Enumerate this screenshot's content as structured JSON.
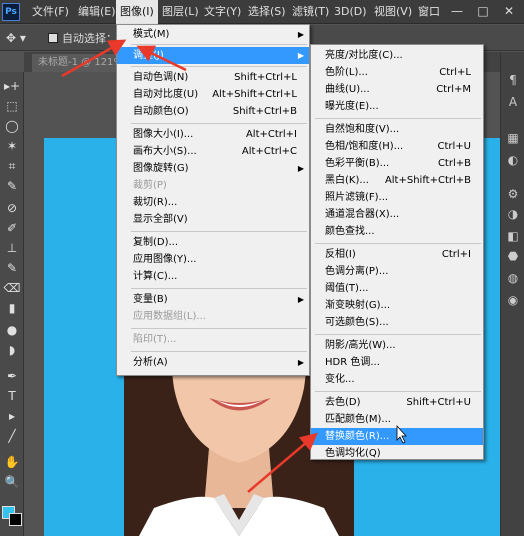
{
  "app": {
    "logo": "Ps"
  },
  "menubar": {
    "items": [
      "文件(F)",
      "编辑(E)",
      "图像(I)",
      "图层(L)",
      "文字(Y)",
      "选择(S)",
      "滤镜(T)",
      "3D(D)",
      "视图(V)",
      "窗口"
    ],
    "window_controls": [
      "—",
      "□",
      "✕"
    ]
  },
  "options_bar": {
    "tool_glyph": "✥ ▾",
    "auto_select_label": "自动选择："
  },
  "doc_tab": {
    "label": "未标题-1 @ 121%"
  },
  "toolbar": {
    "tools": [
      "▸+",
      "⬚",
      "◯",
      "✶",
      "⌗",
      "✎",
      "⊘",
      "✐",
      "⊥",
      "✎",
      "⌫",
      "▮",
      "●",
      "◗",
      "✒",
      "T",
      "▸",
      "╱",
      "✋",
      "🔍"
    ]
  },
  "right_panel": {
    "icons": [
      "¶",
      "A",
      "▦",
      "◐",
      "⚙",
      "◑",
      "◧",
      "⬣",
      "◍",
      "◉"
    ]
  },
  "image_menu": {
    "items": [
      {
        "label": "模式(M)",
        "shortcut": "",
        "submenu": true,
        "disabled": false,
        "highlighted": false
      },
      {
        "label": "调整(J)",
        "shortcut": "",
        "submenu": true,
        "disabled": false,
        "highlighted": true
      },
      {
        "label": "自动色调(N)",
        "shortcut": "Shift+Ctrl+L",
        "submenu": false,
        "disabled": false,
        "highlighted": false
      },
      {
        "label": "自动对比度(U)",
        "shortcut": "Alt+Shift+Ctrl+L",
        "submenu": false,
        "disabled": false,
        "highlighted": false
      },
      {
        "label": "自动颜色(O)",
        "shortcut": "Shift+Ctrl+B",
        "submenu": false,
        "disabled": false,
        "highlighted": false
      },
      {
        "label": "图像大小(I)...",
        "shortcut": "Alt+Ctrl+I",
        "submenu": false,
        "disabled": false,
        "highlighted": false
      },
      {
        "label": "画布大小(S)...",
        "shortcut": "Alt+Ctrl+C",
        "submenu": false,
        "disabled": false,
        "highlighted": false
      },
      {
        "label": "图像旋转(G)",
        "shortcut": "",
        "submenu": true,
        "disabled": false,
        "highlighted": false
      },
      {
        "label": "裁剪(P)",
        "shortcut": "",
        "submenu": false,
        "disabled": true,
        "highlighted": false
      },
      {
        "label": "裁切(R)...",
        "shortcut": "",
        "submenu": false,
        "disabled": false,
        "highlighted": false
      },
      {
        "label": "显示全部(V)",
        "shortcut": "",
        "submenu": false,
        "disabled": false,
        "highlighted": false
      },
      {
        "label": "复制(D)...",
        "shortcut": "",
        "submenu": false,
        "disabled": false,
        "highlighted": false
      },
      {
        "label": "应用图像(Y)...",
        "shortcut": "",
        "submenu": false,
        "disabled": false,
        "highlighted": false
      },
      {
        "label": "计算(C)...",
        "shortcut": "",
        "submenu": false,
        "disabled": false,
        "highlighted": false
      },
      {
        "label": "变量(B)",
        "shortcut": "",
        "submenu": true,
        "disabled": false,
        "highlighted": false
      },
      {
        "label": "应用数据组(L)...",
        "shortcut": "",
        "submenu": false,
        "disabled": true,
        "highlighted": false
      },
      {
        "label": "陷印(T)...",
        "shortcut": "",
        "submenu": false,
        "disabled": true,
        "highlighted": false
      },
      {
        "label": "分析(A)",
        "shortcut": "",
        "submenu": true,
        "disabled": false,
        "highlighted": false
      }
    ]
  },
  "adjust_menu": {
    "items": [
      {
        "label": "亮度/对比度(C)...",
        "shortcut": "",
        "highlighted": false
      },
      {
        "label": "色阶(L)...",
        "shortcut": "Ctrl+L",
        "highlighted": false
      },
      {
        "label": "曲线(U)...",
        "shortcut": "Ctrl+M",
        "highlighted": false
      },
      {
        "label": "曝光度(E)...",
        "shortcut": "",
        "highlighted": false
      },
      {
        "label": "自然饱和度(V)...",
        "shortcut": "",
        "highlighted": false
      },
      {
        "label": "色相/饱和度(H)...",
        "shortcut": "Ctrl+U",
        "highlighted": false
      },
      {
        "label": "色彩平衡(B)...",
        "shortcut": "Ctrl+B",
        "highlighted": false
      },
      {
        "label": "黑白(K)...",
        "shortcut": "Alt+Shift+Ctrl+B",
        "highlighted": false
      },
      {
        "label": "照片滤镜(F)...",
        "shortcut": "",
        "highlighted": false
      },
      {
        "label": "通道混合器(X)...",
        "shortcut": "",
        "highlighted": false
      },
      {
        "label": "颜色查找...",
        "shortcut": "",
        "highlighted": false
      },
      {
        "label": "反相(I)",
        "shortcut": "Ctrl+I",
        "highlighted": false
      },
      {
        "label": "色调分离(P)...",
        "shortcut": "",
        "highlighted": false
      },
      {
        "label": "阈值(T)...",
        "shortcut": "",
        "highlighted": false
      },
      {
        "label": "渐变映射(G)...",
        "shortcut": "",
        "highlighted": false
      },
      {
        "label": "可选颜色(S)...",
        "shortcut": "",
        "highlighted": false
      },
      {
        "label": "阴影/高光(W)...",
        "shortcut": "",
        "highlighted": false
      },
      {
        "label": "HDR 色调...",
        "shortcut": "",
        "highlighted": false
      },
      {
        "label": "变化...",
        "shortcut": "",
        "highlighted": false
      },
      {
        "label": "去色(D)",
        "shortcut": "Shift+Ctrl+U",
        "highlighted": false
      },
      {
        "label": "匹配颜色(M)...",
        "shortcut": "",
        "highlighted": false
      },
      {
        "label": "替换颜色(R)...",
        "shortcut": "",
        "highlighted": true
      },
      {
        "label": "色调均化(Q)",
        "shortcut": "",
        "highlighted": false
      }
    ]
  },
  "colors": {
    "canvas_bg": "#2ab1e9",
    "highlight": "#3399ff",
    "annotation_arrow": "#e8392a",
    "foreground": "#33c3ef",
    "background": "#000000"
  }
}
